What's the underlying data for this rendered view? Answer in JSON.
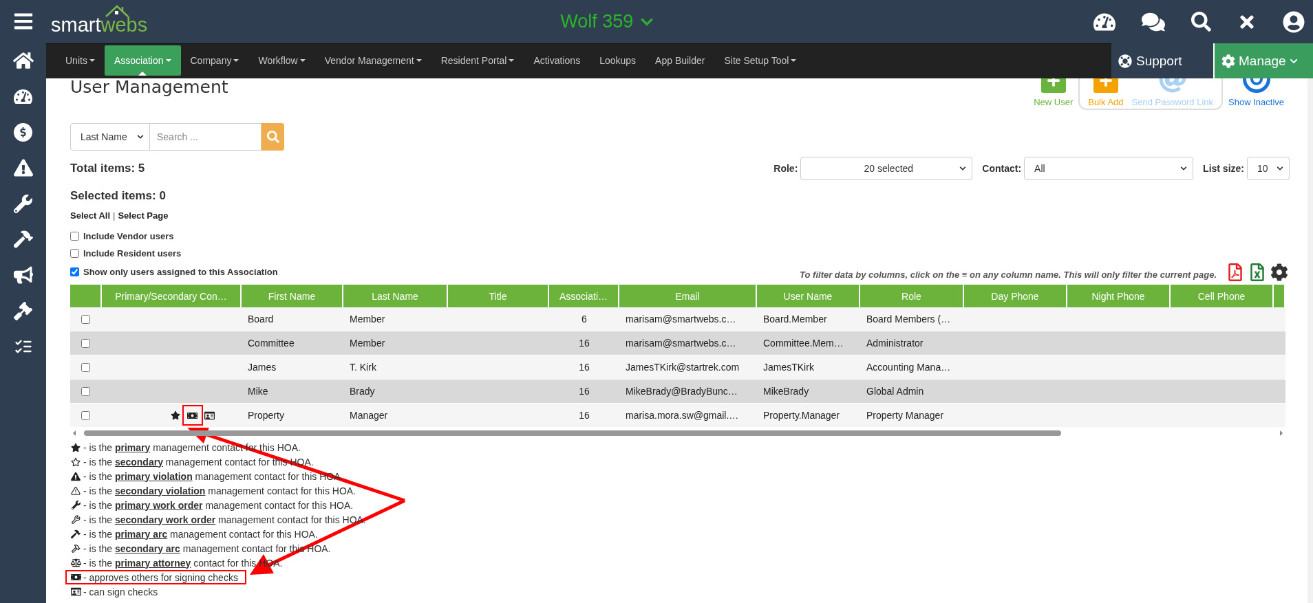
{
  "topbar": {
    "logo": {
      "part_1": "smart",
      "part_2": "webs"
    },
    "association": "Wolf 359"
  },
  "nav": {
    "items": [
      {
        "label": "Units",
        "dropdown": true,
        "selected": false
      },
      {
        "label": "Association",
        "dropdown": true,
        "selected": true
      },
      {
        "label": "Company",
        "dropdown": true,
        "selected": false
      },
      {
        "label": "Workflow",
        "dropdown": true,
        "selected": false
      },
      {
        "label": "Vendor Management",
        "dropdown": true,
        "selected": false
      },
      {
        "label": "Resident Portal",
        "dropdown": true,
        "selected": false
      },
      {
        "label": "Activations",
        "dropdown": false,
        "selected": false
      },
      {
        "label": "Lookups",
        "dropdown": false,
        "selected": false
      },
      {
        "label": "App Builder",
        "dropdown": false,
        "selected": false
      },
      {
        "label": "Site Setup Tool",
        "dropdown": true,
        "selected": false
      }
    ],
    "support": "Support",
    "manage": "Manage"
  },
  "page": {
    "title": "User Management"
  },
  "actions": [
    {
      "label": "New User",
      "kind": "add",
      "color": "#6ab33c",
      "grouped": false
    },
    {
      "label": "Bulk Add",
      "kind": "add",
      "color": "#f5a100",
      "grouped": true
    },
    {
      "label": "Send Password Link",
      "kind": "link",
      "color": "#a9d1f3",
      "grouped": true
    },
    {
      "label": "Show Inactive",
      "kind": "toggle",
      "color": "#1a73d9",
      "grouped": false
    }
  ],
  "search": {
    "by": "Last Name",
    "placeholder": "Search ..."
  },
  "summary": {
    "total": "Total items: 5",
    "selected": "Selected items: 0"
  },
  "selection_links": {
    "all": "Select All",
    "separator": "|",
    "page": "Select Page"
  },
  "options": [
    {
      "label": "Include Vendor users",
      "checked": false
    },
    {
      "label": "Include Resident users",
      "checked": false
    },
    {
      "label": "Show only users assigned to this Association",
      "checked": true
    }
  ],
  "filters": [
    {
      "label": "Role:",
      "value": "20 selected"
    },
    {
      "label": "Contact:",
      "value": "All"
    },
    {
      "label": "List size:",
      "value": "10"
    }
  ],
  "hint": "To filter data by columns, click on the ≡ on any column name. This will only filter the current page.",
  "table": {
    "columns": [
      "Primary/Secondary Con…",
      "First Name",
      "Last Name",
      "Title",
      "Associati…",
      "Email",
      "User Name",
      "Role",
      "Day Phone",
      "Night Phone",
      "Cell Phone"
    ],
    "rows": [
      {
        "checked": false,
        "first_name": "Board",
        "last_name": "Member",
        "associations": "6",
        "email": "marisam@smartwebs.c…",
        "user_name": "Board.Member",
        "role": "Board Members (…"
      },
      {
        "checked": false,
        "first_name": "Committee",
        "last_name": "Member",
        "associations": "16",
        "email": "marisam@smartwebs.c…",
        "user_name": "Committee.Mem…",
        "role": "Administrator"
      },
      {
        "checked": false,
        "first_name": "James",
        "last_name": "T. Kirk",
        "associations": "16",
        "email": "JamesTKirk@startrek.com",
        "user_name": "JamesTKirk",
        "role": "Accounting Mana…"
      },
      {
        "checked": false,
        "first_name": "Mike",
        "last_name": "Brady",
        "associations": "16",
        "email": "MikeBrady@BradyBunc…",
        "user_name": "MikeBrady",
        "role": "Global Admin"
      },
      {
        "checked": false,
        "contact_icons": [
          {
            "kind": "star",
            "highlighted": false
          },
          {
            "kind": "cash",
            "highlighted": true
          },
          {
            "kind": "card",
            "highlighted": false
          }
        ],
        "first_name": "Property",
        "last_name": "Manager",
        "associations": "16",
        "email": "marisa.mora.sw@gmail.…",
        "user_name": "Property.Manager",
        "role": "Property Manager"
      }
    ]
  },
  "legend": [
    {
      "kind": "star",
      "text": "- is the **primary** management contact for this HOA.",
      "highlighted": false
    },
    {
      "kind": "star-outline",
      "text": "- is the **secondary** management contact for this HOA.",
      "highlighted": false
    },
    {
      "kind": "warning",
      "text": "- is the **primary violation** management contact for this HOA.",
      "highlighted": false
    },
    {
      "kind": "warning-outline",
      "text": "- is the **secondary violation** management contact for this HOA.",
      "highlighted": false
    },
    {
      "kind": "wrench",
      "text": "- is the **primary work order** management contact for this HOA.",
      "highlighted": false
    },
    {
      "kind": "wrench-outline",
      "text": "- is the **secondary work order** management contact for this HOA.",
      "highlighted": false
    },
    {
      "kind": "hammer",
      "text": "- is the **primary arc** management contact for this HOA.",
      "highlighted": false
    },
    {
      "kind": "hammer-outline",
      "text": "- is the **secondary arc** management contact for this HOA.",
      "highlighted": false
    },
    {
      "kind": "scale",
      "text": "- is the **primary attorney** contact for this HOA.",
      "highlighted": false
    },
    {
      "kind": "cash",
      "text": "- approves others for signing checks",
      "highlighted": true
    },
    {
      "kind": "card",
      "text": "- can sign checks",
      "highlighted": false
    }
  ]
}
